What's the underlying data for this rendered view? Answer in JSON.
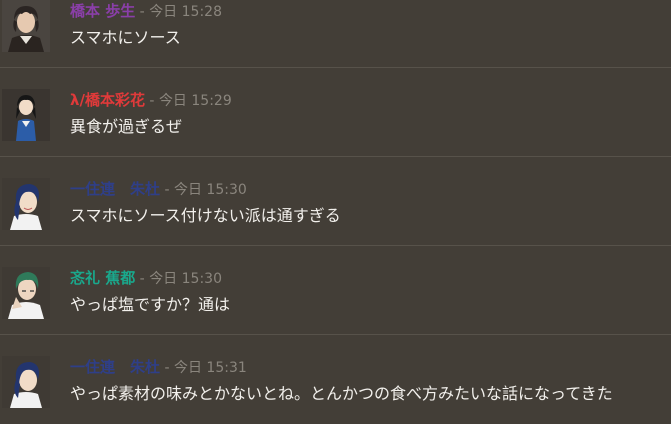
{
  "meta_separator": " - ",
  "colors": {
    "background": "#433e37",
    "divider": "#57524a",
    "timestamp": "#8a857d",
    "message_text": "#f2f0ec"
  },
  "messages": [
    {
      "author": "橋本 歩生",
      "author_color": "#8a3fa8",
      "timestamp": "今日 15:28",
      "text": "スマホにソース",
      "avatar_icon": "man-with-curly-hair-avatar-icon"
    },
    {
      "author": "λ/橋本彩花",
      "author_color": "#e03a3a",
      "timestamp": "今日 15:29",
      "text": "異食が過ぎるぜ",
      "avatar_icon": "woman-in-blue-uniform-avatar-icon"
    },
    {
      "author": "一住連　朱杜",
      "author_color": "#2f3f88",
      "timestamp": "今日 15:30",
      "text": "スマホにソース付けない派は通すぎる",
      "avatar_icon": "person-with-blue-hair-avatar-icon"
    },
    {
      "author": "忞礼 蕉都",
      "author_color": "#1aa88c",
      "timestamp": "今日 15:30",
      "text": "やっぱ塩ですか？通は",
      "avatar_icon": "man-with-green-hair-avatar-icon"
    },
    {
      "author": "一住連　朱杜",
      "author_color": "#2f3f88",
      "timestamp": "今日 15:31",
      "text": "やっぱ素材の味みとかないとね。とんかつの食べ方みたいな話になってきた",
      "avatar_icon": "person-with-blue-hair-avatar-icon"
    }
  ]
}
